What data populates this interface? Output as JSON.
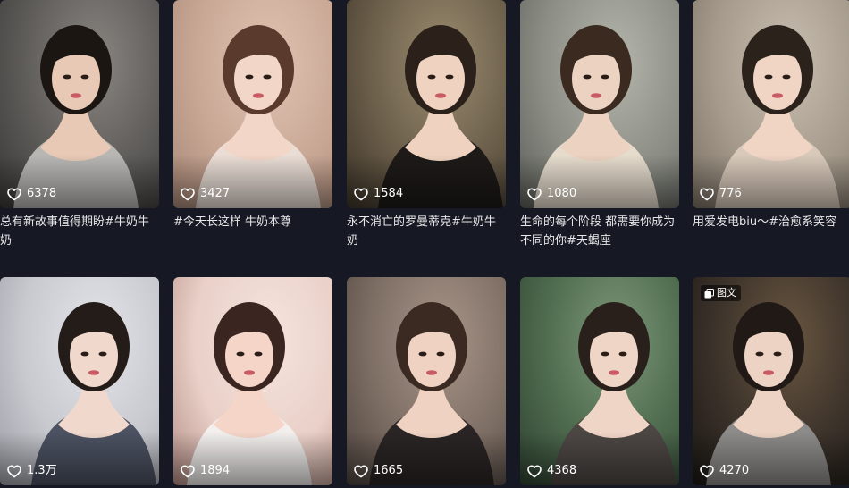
{
  "videos": [
    {
      "likes": "6378",
      "caption": "总有新故事值得期盼#牛奶牛奶",
      "palette": [
        "#5d5b58",
        "#8a8682",
        "#3a3836"
      ],
      "skin": "#e8c9b5",
      "hair": "#1c1613",
      "cloth": "#b9b7b4"
    },
    {
      "likes": "3427",
      "caption": "#今天长这样 牛奶本尊",
      "palette": [
        "#c9a795",
        "#e0c3b2",
        "#a78877"
      ],
      "skin": "#f2d6c8",
      "hair": "#5a3a2c",
      "cloth": "#e9ddd5"
    },
    {
      "likes": "1584",
      "caption": "永不消亡的罗曼蒂克#牛奶牛奶",
      "palette": [
        "#6b5e4a",
        "#9c8d70",
        "#3c3428"
      ],
      "skin": "#efd3c0",
      "hair": "#2b201a",
      "cloth": "#1d1a18"
    },
    {
      "likes": "1080",
      "caption": "生命的每个阶段 都需要你成为不同的你#天蝎座",
      "palette": [
        "#8c8e86",
        "#b4b6ac",
        "#5c5e58"
      ],
      "skin": "#ecd2c0",
      "hair": "#3a2a20",
      "cloth": "#e6dccd"
    },
    {
      "likes": "776",
      "caption": "用爱发电biu～#治愈系笑容",
      "palette": [
        "#a59a8b",
        "#c9bfb2",
        "#7b7165"
      ],
      "skin": "#f0d4c4",
      "hair": "#2c221c",
      "cloth": "#d8c9ba"
    },
    {
      "likes": "1.3万",
      "caption": "",
      "palette": [
        "#c8c9cf",
        "#e4e5ea",
        "#9d9ea6"
      ],
      "skin": "#f0d8cc",
      "hair": "#241c18",
      "cloth": "#4c5262"
    },
    {
      "likes": "1894",
      "caption": "",
      "palette": [
        "#e9d0c8",
        "#f5e4dd",
        "#b58f86"
      ],
      "skin": "#f4d5c8",
      "hair": "#3a2520",
      "cloth": "#f2efed"
    },
    {
      "likes": "1665",
      "caption": "",
      "palette": [
        "#7d6e64",
        "#a99589",
        "#4d433d"
      ],
      "skin": "#efd2c2",
      "hair": "#3b2a22",
      "cloth": "#2a2524"
    },
    {
      "likes": "4368",
      "caption": "",
      "palette": [
        "#4e6a4e",
        "#7d9878",
        "#2e4230"
      ],
      "skin": "#efd5c6",
      "hair": "#2a201b",
      "cloth": "#4d4744"
    },
    {
      "likes": "4270",
      "caption": "",
      "palette": [
        "#3b322a",
        "#6a5640",
        "#1c1814"
      ],
      "skin": "#ecd3c3",
      "hair": "#201915",
      "cloth": "#8c8b89",
      "badge": "图文"
    }
  ]
}
